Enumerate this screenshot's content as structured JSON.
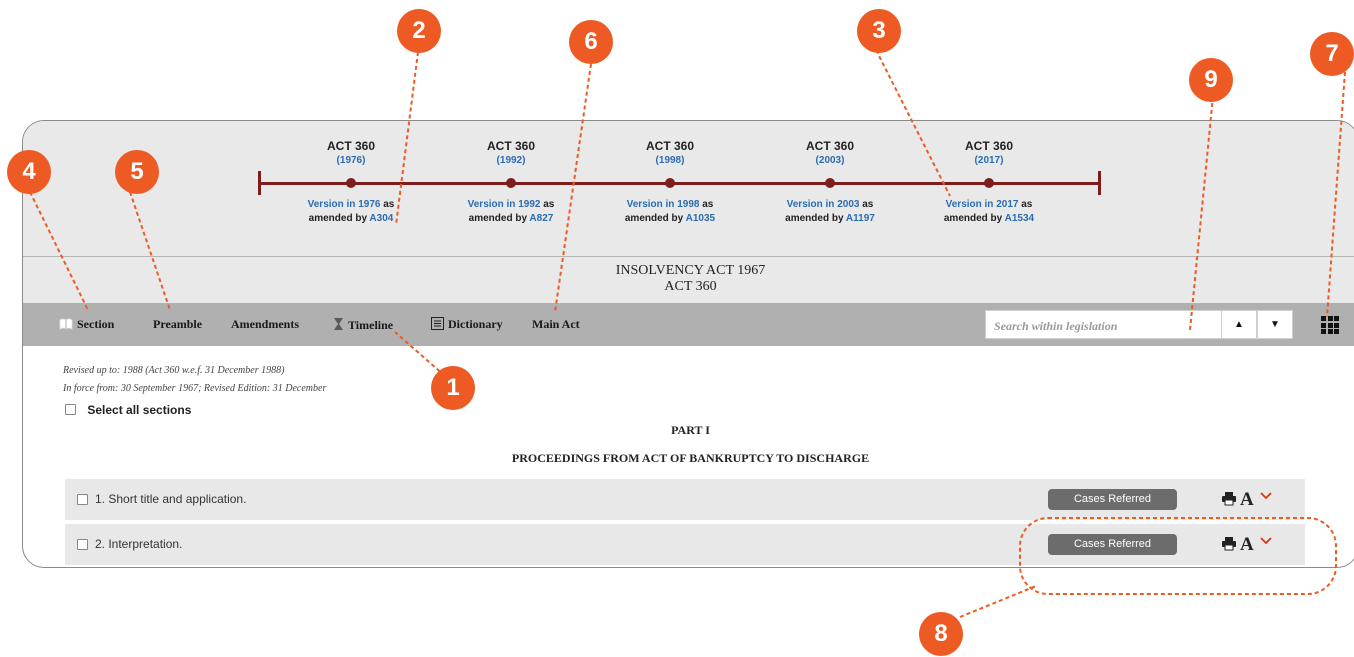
{
  "timeline": {
    "acts": [
      {
        "title": "ACT 360",
        "year": "(1976)",
        "ver_pre": "Version in 1976",
        "ver_as": " as",
        "ver_by": "amended by ",
        "amend": "A304"
      },
      {
        "title": "ACT 360",
        "year": "(1992)",
        "ver_pre": "Version in 1992",
        "ver_as": " as",
        "ver_by": "amended by ",
        "amend": "A827"
      },
      {
        "title": "ACT 360",
        "year": "(1998)",
        "ver_pre": "Version in 1998",
        "ver_as": " as",
        "ver_by": "amended by ",
        "amend": "A1035"
      },
      {
        "title": "ACT 360",
        "year": "(2003)",
        "ver_pre": "Version in 2003",
        "ver_as": " as",
        "ver_by": "amended by ",
        "amend": "A1197"
      },
      {
        "title": "ACT 360",
        "year": "(2017)",
        "ver_pre": "Version in 2017",
        "ver_as": " as",
        "ver_by": "amended by ",
        "amend": "A1534"
      }
    ]
  },
  "header": {
    "title": "INSOLVENCY ACT 1967",
    "subtitle": "ACT 360"
  },
  "toolbar": {
    "section": "Section",
    "preamble": "Preamble",
    "amendments": "Amendments",
    "timeline": "Timeline",
    "dictionary": "Dictionary",
    "main_act": "Main Act",
    "search_placeholder": "Search within legislation",
    "up": "▲",
    "down": "▼"
  },
  "meta": {
    "revised": "Revised up to: 1988 (Act 360 w.e.f. 31 December 1988)",
    "in_force": "In force from: 30 September 1967; Revised Edition: 31 December"
  },
  "select_all": "Select all sections",
  "part": {
    "heading": "PART I",
    "title": "PROCEEDINGS FROM ACT OF BANKRUPTCY TO DISCHARGE"
  },
  "sections": [
    {
      "label": "1. Short title and application.",
      "cases": "Cases Referred"
    },
    {
      "label": "2. Interpretation.",
      "cases": "Cases Referred"
    }
  ],
  "icons": {
    "print": "print-icon",
    "font": "font-size-icon",
    "chevron": "chevron-down-icon",
    "grid": "grid-icon",
    "book": "book-icon",
    "hourglass": "hourglass-icon",
    "dictionary": "dictionary-icon"
  },
  "callouts": [
    "1",
    "2",
    "3",
    "4",
    "5",
    "6",
    "7",
    "8",
    "9"
  ],
  "colors": {
    "callout": "#ee5a24",
    "timeline": "#7e1d1d",
    "link": "#2b6cb0",
    "toolbar": "#b0b0b0"
  }
}
